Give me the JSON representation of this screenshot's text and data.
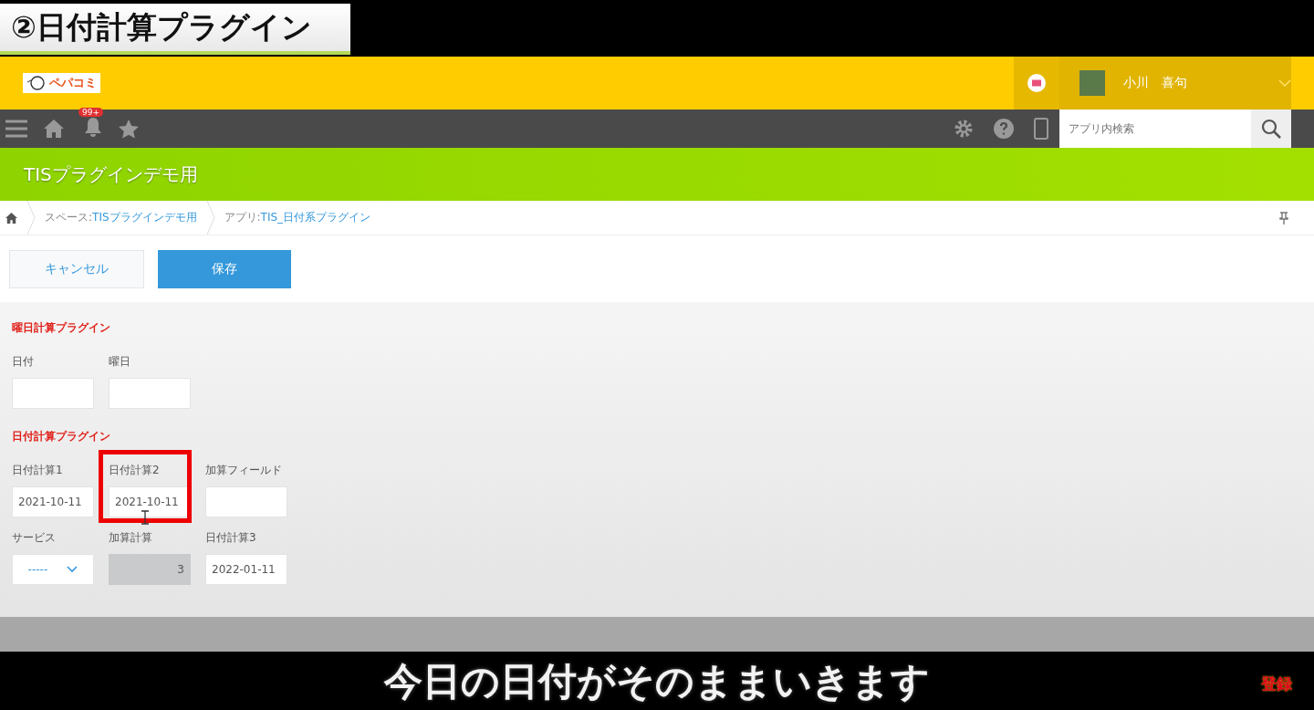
{
  "video_title": "②日付計算プラグイン",
  "header": {
    "logo_text": "ペパコミ",
    "user_name": "小川　喜句"
  },
  "nav": {
    "badge": "99+",
    "search": {
      "placeholder": "アプリ内検索"
    }
  },
  "space_title": "TISプラグインデモ用",
  "breadcrumb": [
    {
      "prefix": "スペース: ",
      "link": "TISプラグインデモ用"
    },
    {
      "prefix": "アプリ: ",
      "link": "TIS_日付系プラグイン"
    }
  ],
  "buttons": [
    {
      "label": "キャンセル",
      "kind": "secondary"
    },
    {
      "label": "保存",
      "kind": "primary"
    }
  ],
  "sections": [
    {
      "title": "曜日計算プラグイン",
      "rows": [
        [
          {
            "label": "日付",
            "kind": "text",
            "highlighted": false
          },
          {
            "label": "曜日",
            "kind": "text",
            "highlighted": false
          }
        ]
      ]
    },
    {
      "title": "日付計算プラグイン",
      "rows": [
        [
          {
            "label": "日付計算1",
            "kind": "text",
            "value": "2021-10-11",
            "highlighted": false
          },
          {
            "label": "日付計算2",
            "kind": "text",
            "value": "2021-10-11",
            "highlighted": true
          },
          {
            "label": "加算フィールド",
            "kind": "text",
            "highlighted": false
          }
        ],
        [
          {
            "label": "サービス",
            "kind": "select",
            "value": "-----",
            "highlighted": false
          },
          {
            "label": "加算計算",
            "kind": "calc",
            "value": "3",
            "highlighted": false
          },
          {
            "label": "日付計算3",
            "kind": "text",
            "value": "2022-01-11",
            "highlighted": false
          }
        ]
      ]
    }
  ],
  "subtitle": "今日の日付がそのままいきます",
  "subscribe_label": "登録"
}
